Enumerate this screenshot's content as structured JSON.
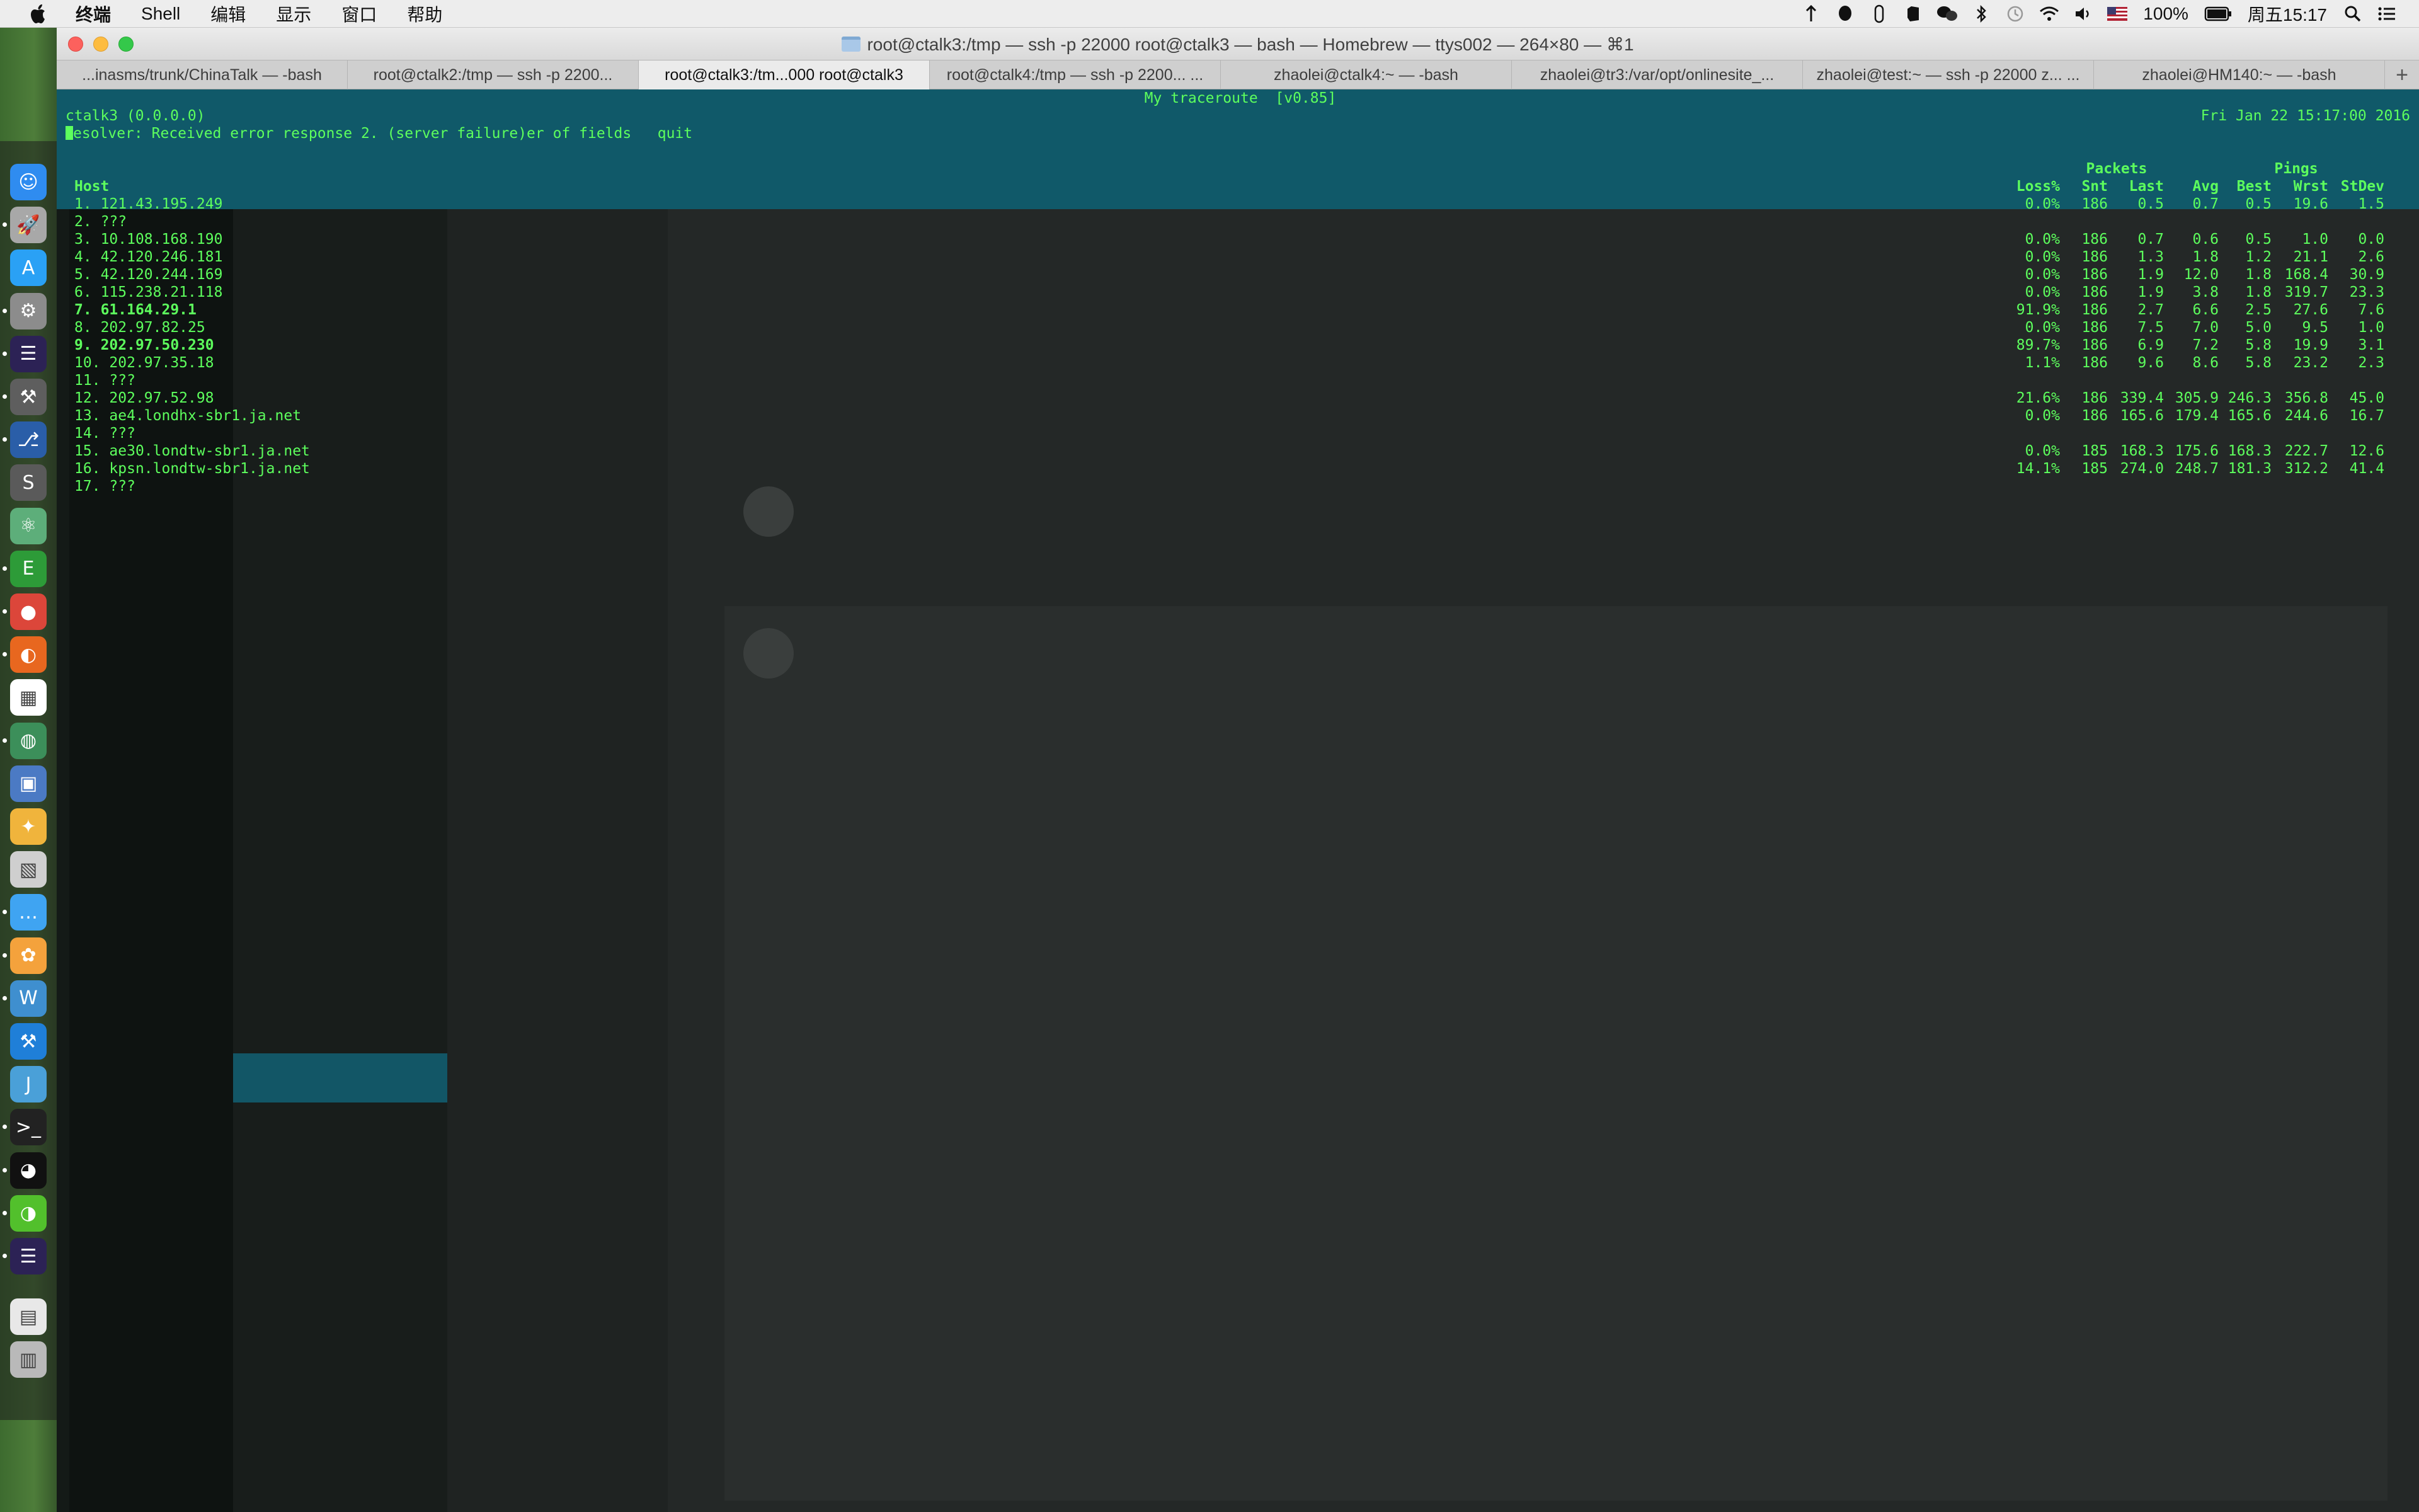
{
  "menubar": {
    "items": [
      "终端",
      "Shell",
      "编辑",
      "显示",
      "窗口",
      "帮助"
    ],
    "battery": "100%",
    "clock": "周五15:17"
  },
  "window": {
    "title": "root@ctalk3:/tmp — ssh -p 22000 root@ctalk3 — bash — Homebrew — ttys002 — 264×80 — ⌘1",
    "tabs": [
      "...inasms/trunk/ChinaTalk — -bash",
      "root@ctalk2:/tmp — ssh -p 2200...",
      "root@ctalk3:/tm...000 root@ctalk3",
      "root@ctalk4:/tmp — ssh -p 2200... ...",
      "zhaolei@ctalk4:~ — -bash",
      "zhaolei@tr3:/var/opt/onlinesite_...",
      "zhaolei@test:~ — ssh -p 22000 z... ...",
      "zhaolei@HM140:~ — -bash"
    ],
    "active_tab": 2
  },
  "mtr": {
    "header_title": "My traceroute  [v0.85]",
    "host_line": "ctalk3 (0.0.0.0)",
    "date": "Fri Jan 22 15:17:00 2016",
    "resolver_line": "esolver: Received error response 2. (server failure)er of fields   quit",
    "packets_label": "Packets",
    "pings_label": "Pings",
    "col_host": "Host",
    "columns": [
      "Loss%",
      "Snt",
      "Last",
      "Avg",
      "Best",
      "Wrst",
      "StDev"
    ],
    "hops": [
      {
        "n": "1.",
        "host": "121.43.195.249",
        "bold": false,
        "loss": "0.0%",
        "snt": "186",
        "last": "0.5",
        "avg": "0.7",
        "best": "0.5",
        "wrst": "19.6",
        "stdev": "1.5"
      },
      {
        "n": "2.",
        "host": "???",
        "bold": false,
        "loss": "",
        "snt": "",
        "last": "",
        "avg": "",
        "best": "",
        "wrst": "",
        "stdev": ""
      },
      {
        "n": "3.",
        "host": "10.108.168.190",
        "bold": false,
        "loss": "0.0%",
        "snt": "186",
        "last": "0.7",
        "avg": "0.6",
        "best": "0.5",
        "wrst": "1.0",
        "stdev": "0.0"
      },
      {
        "n": "4.",
        "host": "42.120.246.181",
        "bold": false,
        "loss": "0.0%",
        "snt": "186",
        "last": "1.3",
        "avg": "1.8",
        "best": "1.2",
        "wrst": "21.1",
        "stdev": "2.6"
      },
      {
        "n": "5.",
        "host": "42.120.244.169",
        "bold": false,
        "loss": "0.0%",
        "snt": "186",
        "last": "1.9",
        "avg": "12.0",
        "best": "1.8",
        "wrst": "168.4",
        "stdev": "30.9"
      },
      {
        "n": "6.",
        "host": "115.238.21.118",
        "bold": false,
        "loss": "0.0%",
        "snt": "186",
        "last": "1.9",
        "avg": "3.8",
        "best": "1.8",
        "wrst": "319.7",
        "stdev": "23.3"
      },
      {
        "n": "7.",
        "host": "61.164.29.1",
        "bold": true,
        "loss": "91.9%",
        "snt": "186",
        "last": "2.7",
        "avg": "6.6",
        "best": "2.5",
        "wrst": "27.6",
        "stdev": "7.6"
      },
      {
        "n": "8.",
        "host": "202.97.82.25",
        "bold": false,
        "loss": "0.0%",
        "snt": "186",
        "last": "7.5",
        "avg": "7.0",
        "best": "5.0",
        "wrst": "9.5",
        "stdev": "1.0"
      },
      {
        "n": "9.",
        "host": "202.97.50.230",
        "bold": true,
        "loss": "89.7%",
        "snt": "186",
        "last": "6.9",
        "avg": "7.2",
        "best": "5.8",
        "wrst": "19.9",
        "stdev": "3.1"
      },
      {
        "n": "10.",
        "host": "202.97.35.18",
        "bold": false,
        "loss": "1.1%",
        "snt": "186",
        "last": "9.6",
        "avg": "8.6",
        "best": "5.8",
        "wrst": "23.2",
        "stdev": "2.3"
      },
      {
        "n": "11.",
        "host": "???",
        "bold": false,
        "loss": "",
        "snt": "",
        "last": "",
        "avg": "",
        "best": "",
        "wrst": "",
        "stdev": ""
      },
      {
        "n": "12.",
        "host": "202.97.52.98",
        "bold": false,
        "loss": "21.6%",
        "snt": "186",
        "last": "339.4",
        "avg": "305.9",
        "best": "246.3",
        "wrst": "356.8",
        "stdev": "45.0"
      },
      {
        "n": "13.",
        "host": "ae4.londhx-sbr1.ja.net",
        "bold": false,
        "loss": "0.0%",
        "snt": "186",
        "last": "165.6",
        "avg": "179.4",
        "best": "165.6",
        "wrst": "244.6",
        "stdev": "16.7"
      },
      {
        "n": "14.",
        "host": "???",
        "bold": false,
        "loss": "",
        "snt": "",
        "last": "",
        "avg": "",
        "best": "",
        "wrst": "",
        "stdev": ""
      },
      {
        "n": "15.",
        "host": "ae30.londtw-sbr1.ja.net",
        "bold": false,
        "loss": "0.0%",
        "snt": "185",
        "last": "168.3",
        "avg": "175.6",
        "best": "168.3",
        "wrst": "222.7",
        "stdev": "12.6"
      },
      {
        "n": "16.",
        "host": "kpsn.londtw-sbr1.ja.net",
        "bold": false,
        "loss": "14.1%",
        "snt": "185",
        "last": "274.0",
        "avg": "248.7",
        "best": "181.3",
        "wrst": "312.2",
        "stdev": "41.4"
      },
      {
        "n": "17.",
        "host": "???",
        "bold": false,
        "loss": "",
        "snt": "",
        "last": "",
        "avg": "",
        "best": "",
        "wrst": "",
        "stdev": ""
      }
    ]
  },
  "colors": {
    "terminal_text": "#5dff5d",
    "terminal_bg": "#14201a",
    "accent_cyan": "#0f6f86"
  },
  "dock_icons": [
    "finder-icon",
    "launchpad-icon",
    "app-store-icon",
    "system-preferences-icon",
    "eclipse-icon",
    "instruments-icon",
    "sourcetree-icon",
    "sublime-text-icon",
    "atom-icon",
    "evernote-icon",
    "chrome-icon",
    "firefox-icon",
    "grid-app-icon",
    "earth-browser-icon",
    "virtualbox-icon",
    "lightbulb-icon",
    "image-preview-icon",
    "messages-icon",
    "photos-icon",
    "webstorm-icon",
    "xcode-icon",
    "intellij-icon",
    "terminal-icon",
    "qq-icon",
    "wechat-icon",
    "eclipse-2-icon",
    "document-icon",
    "trash-icon"
  ]
}
